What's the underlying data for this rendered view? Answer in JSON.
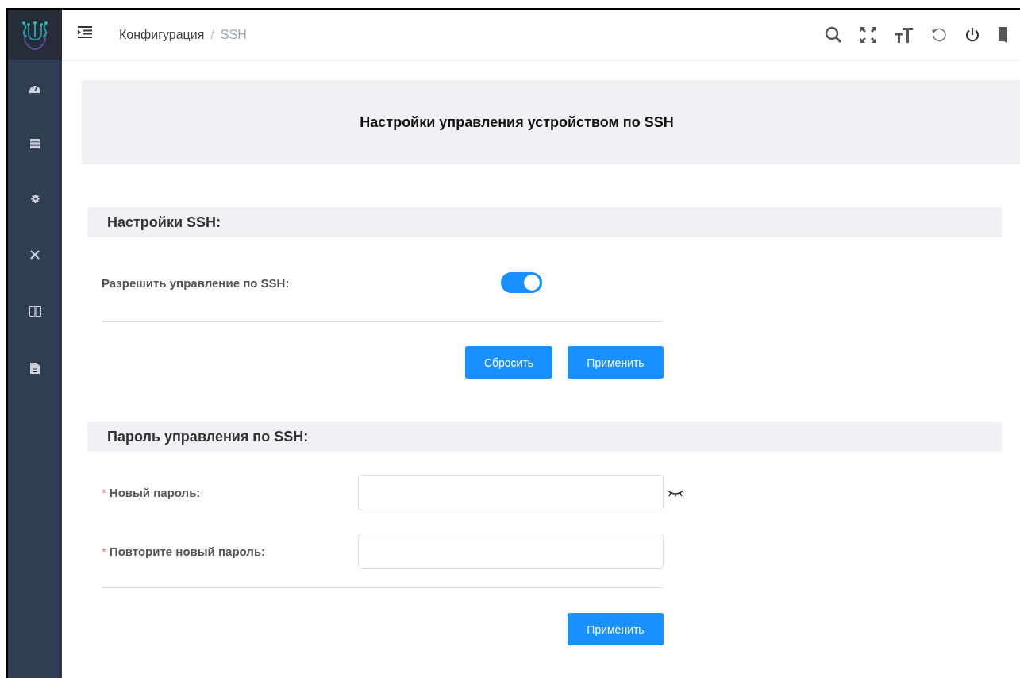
{
  "header": {
    "breadcrumb": [
      {
        "label": "Конфигурация",
        "current": false
      },
      {
        "label": "SSH",
        "current": true
      }
    ],
    "separator": "/"
  },
  "page_title": "Настройки управления устройством по SSH",
  "sections": [
    {
      "title": "Настройки SSH:",
      "rows": [
        {
          "kind": "toggle",
          "label": "Разрешить управление по SSH:",
          "on": true
        }
      ],
      "buttons": [
        "Сбросить",
        "Применить"
      ]
    },
    {
      "title": "Пароль управления по SSH:",
      "rows": [
        {
          "kind": "password",
          "required_mark": "*",
          "label": "Новый пароль:",
          "eye_icon": true
        },
        {
          "kind": "password",
          "required_mark": "*",
          "label": "Повторите новый пароль:",
          "eye_icon": false
        }
      ],
      "buttons": [
        "Применить"
      ]
    }
  ]
}
